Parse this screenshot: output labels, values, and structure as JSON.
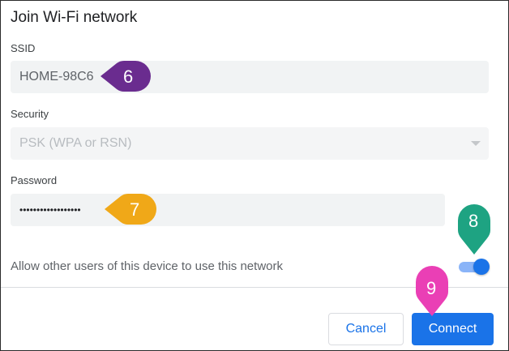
{
  "dialog": {
    "title": "Join Wi-Fi network",
    "ssid_label": "SSID",
    "ssid_value": "HOME-98C6",
    "security_label": "Security",
    "security_value": "PSK (WPA or RSN)",
    "password_label": "Password",
    "password_value": "••••••••••••••••••",
    "allow_label": "Allow other users of this device to use this network",
    "allow_enabled": true,
    "cancel_label": "Cancel",
    "connect_label": "Connect"
  },
  "callouts": [
    {
      "number": "6",
      "color": "#6a2c8f"
    },
    {
      "number": "7",
      "color": "#f0a818"
    },
    {
      "number": "8",
      "color": "#1ea382"
    },
    {
      "number": "9",
      "color": "#ea3fb5"
    }
  ],
  "colors": {
    "accent": "#1a73e8",
    "field_bg": "#f1f3f4"
  }
}
